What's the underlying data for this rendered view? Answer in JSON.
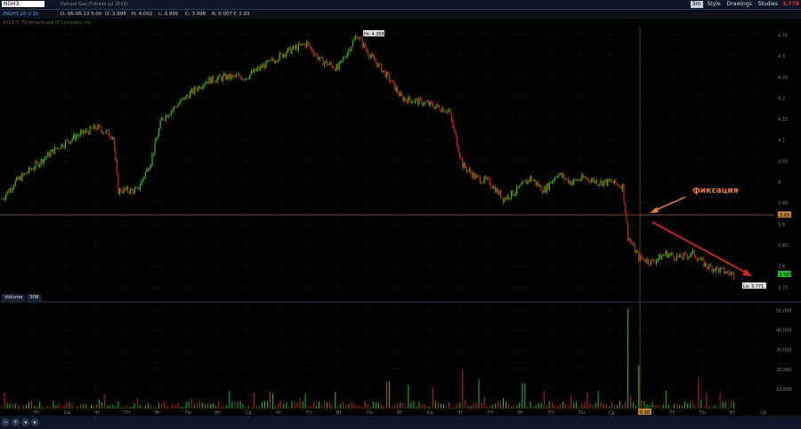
{
  "toolbar": {
    "symbol": "NGH3",
    "description": "Natural Gas (Futures Jul 2013)",
    "timeframe": "3m",
    "style_label": "Style",
    "drawings_label": "Drawings",
    "studies_label": "Studies",
    "last_price": "3.778"
  },
  "infobar": {
    "series_label": "/NGH3 20 d 1h",
    "date": "D: 06.06.13 5:00",
    "open": "O: 3.998",
    "high": "H: 4.002",
    "low": "L: 3.995",
    "close": "C: 3.998",
    "range": "R: 0.007",
    "y": "Y: 3.93"
  },
  "copyright": "2013 © TD Ameritrade IP Company, Inc.",
  "volume_panel": {
    "label": "Volume",
    "count": "308"
  },
  "annotation": {
    "text": "фиксация",
    "arrow_color": "#e87f2a",
    "trend_color": "#e02020"
  },
  "price_tags": {
    "high": "Hi: 4.358",
    "low": "Lo: 3.771",
    "crosshair": "3.93",
    "current": "3.787"
  },
  "chart_data": {
    "type": "candlestick",
    "y_ticks": [
      "4.35",
      "4.3",
      "4.25",
      "4.2",
      "4.15",
      "4.1",
      "4.05",
      "4",
      "3.95",
      "3.9",
      "3.85",
      "3.8",
      "3.75"
    ],
    "ylim": [
      3.74,
      4.37
    ],
    "volume_ticks": [
      "50,000",
      "40,000",
      "30,000",
      "20,000",
      "10,000"
    ],
    "volume_ylim": [
      0,
      52000
    ],
    "x_ticks": [
      "Пт",
      "Ср",
      "Чт",
      "Пт",
      "Вт",
      "Пн",
      "Вт",
      "Ср",
      "Чт",
      "Пт",
      "Вт",
      "Пн",
      "Вт",
      "Ср",
      "Чт",
      "Пт",
      "Вт",
      "Пт",
      "Пн",
      "Ср",
      "Чт",
      "Пт",
      "Пн",
      "Вт",
      "Ср"
    ],
    "x_current": "6.00",
    "close_path": [
      {
        "i": 0,
        "v": 3.96
      },
      {
        "i": 10,
        "v": 4.0
      },
      {
        "i": 25,
        "v": 4.04
      },
      {
        "i": 40,
        "v": 4.08
      },
      {
        "i": 55,
        "v": 4.11
      },
      {
        "i": 70,
        "v": 4.13
      },
      {
        "i": 82,
        "v": 4.11
      },
      {
        "i": 86,
        "v": 3.98
      },
      {
        "i": 100,
        "v": 3.98
      },
      {
        "i": 110,
        "v": 4.05
      },
      {
        "i": 118,
        "v": 4.15
      },
      {
        "i": 135,
        "v": 4.2
      },
      {
        "i": 150,
        "v": 4.24
      },
      {
        "i": 165,
        "v": 4.25
      },
      {
        "i": 180,
        "v": 4.25
      },
      {
        "i": 195,
        "v": 4.28
      },
      {
        "i": 210,
        "v": 4.31
      },
      {
        "i": 225,
        "v": 4.33
      },
      {
        "i": 235,
        "v": 4.29
      },
      {
        "i": 248,
        "v": 4.27
      },
      {
        "i": 262,
        "v": 4.35
      },
      {
        "i": 272,
        "v": 4.3
      },
      {
        "i": 285,
        "v": 4.25
      },
      {
        "i": 295,
        "v": 4.2
      },
      {
        "i": 310,
        "v": 4.19
      },
      {
        "i": 320,
        "v": 4.18
      },
      {
        "i": 330,
        "v": 4.17
      },
      {
        "i": 340,
        "v": 4.04
      },
      {
        "i": 350,
        "v": 4.01
      },
      {
        "i": 360,
        "v": 4.0
      },
      {
        "i": 370,
        "v": 3.96
      },
      {
        "i": 380,
        "v": 3.98
      },
      {
        "i": 390,
        "v": 4.01
      },
      {
        "i": 400,
        "v": 3.98
      },
      {
        "i": 410,
        "v": 4.02
      },
      {
        "i": 420,
        "v": 4.0
      },
      {
        "i": 430,
        "v": 4.01
      },
      {
        "i": 440,
        "v": 4.0
      },
      {
        "i": 450,
        "v": 4.0
      },
      {
        "i": 458,
        "v": 3.99
      },
      {
        "i": 462,
        "v": 3.87
      },
      {
        "i": 470,
        "v": 3.82
      },
      {
        "i": 480,
        "v": 3.81
      },
      {
        "i": 490,
        "v": 3.83
      },
      {
        "i": 500,
        "v": 3.82
      },
      {
        "i": 510,
        "v": 3.83
      },
      {
        "i": 520,
        "v": 3.8
      },
      {
        "i": 530,
        "v": 3.79
      },
      {
        "i": 540,
        "v": 3.78
      }
    ],
    "volume_spikes": [
      {
        "i": 285,
        "v": 14000
      },
      {
        "i": 300,
        "v": 12000
      },
      {
        "i": 318,
        "v": 11000
      },
      {
        "i": 340,
        "v": 20000
      },
      {
        "i": 352,
        "v": 15000
      },
      {
        "i": 385,
        "v": 13000
      },
      {
        "i": 400,
        "v": 9000
      },
      {
        "i": 420,
        "v": 8000
      },
      {
        "i": 440,
        "v": 9000
      },
      {
        "i": 462,
        "v": 51000
      },
      {
        "i": 470,
        "v": 22000
      },
      {
        "i": 490,
        "v": 9000
      },
      {
        "i": 515,
        "v": 16000
      },
      {
        "i": 530,
        "v": 8000
      }
    ]
  }
}
